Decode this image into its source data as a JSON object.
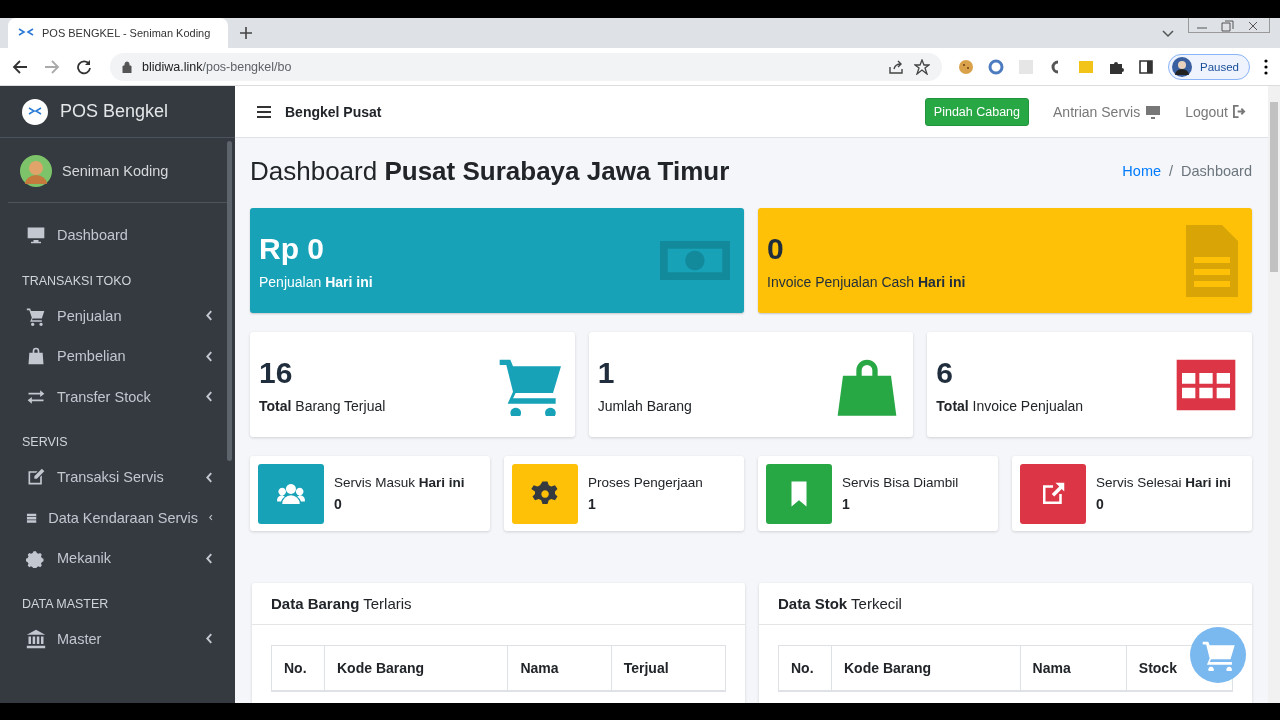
{
  "browser": {
    "tab_title": "POS BENGKEL - Seniman Koding",
    "url_host": "blidiwa.link",
    "url_path": "/pos-bengkel/bo",
    "profile_label": "Paused"
  },
  "sidebar": {
    "brand": "POS Bengkel",
    "user": "Seniman Koding",
    "menu": [
      {
        "kind": "item",
        "label": "Dashboard",
        "caret": false
      },
      {
        "kind": "header",
        "label": "TRANSAKSI TOKO"
      },
      {
        "kind": "item",
        "label": "Penjualan",
        "caret": true
      },
      {
        "kind": "item",
        "label": "Pembelian",
        "caret": true
      },
      {
        "kind": "item",
        "label": "Transfer Stock",
        "caret": true
      },
      {
        "kind": "header",
        "label": "SERVIS"
      },
      {
        "kind": "item",
        "label": "Transaksi Servis",
        "caret": true
      },
      {
        "kind": "item",
        "label": "Data Kendaraan Servis",
        "caret": true
      },
      {
        "kind": "item",
        "label": "Mekanik",
        "caret": true
      },
      {
        "kind": "header",
        "label": "DATA MASTER"
      },
      {
        "kind": "item",
        "label": "Master",
        "caret": true
      }
    ]
  },
  "navbar": {
    "title": "Bengkel Pusat",
    "branch_button": "Pindah Cabang",
    "queue_link": "Antrian Servis",
    "logout_link": "Logout"
  },
  "page": {
    "title": "Dashboard **Pusat Surabaya Jawa Timur**",
    "separator": "/",
    "breadcrumb": [
      {
        "label": "Home",
        "selected": false
      },
      {
        "label": "Dashboard",
        "selected": true
      }
    ]
  },
  "big_cards": [
    {
      "value": "Rp 0",
      "label": "Penjualan **Hari ini**",
      "color": "#17a2b8"
    },
    {
      "value": "0",
      "label": "Invoice Penjualan Cash **Hari ini**",
      "color": "#ffc107"
    }
  ],
  "stat_cards": [
    {
      "value": "16",
      "label": "**Total** Barang Terjual",
      "color": "#17a2b8"
    },
    {
      "value": "1",
      "label": "Jumlah Barang",
      "color": "#28a745"
    },
    {
      "value": "6",
      "label": "**Total** Invoice Penjualan",
      "color": "#dc3545"
    }
  ],
  "service_cards": [
    {
      "label": "Servis Masuk **Hari ini**",
      "value": "0",
      "color": "#17a2b8"
    },
    {
      "label": "Proses Pengerjaan",
      "value": "1",
      "color": "#ffc107"
    },
    {
      "label": "Servis Bisa Diambil",
      "value": "1",
      "color": "#28a745"
    },
    {
      "label": "Servis Selesai **Hari ini**",
      "value": "0",
      "color": "#dc3545"
    }
  ],
  "tables": [
    {
      "title": "**Data Barang** Terlaris",
      "columns": [
        "No.",
        "Kode Barang",
        "Nama",
        "Terjual"
      ]
    },
    {
      "title": "**Data Stok** Terkecil",
      "columns": [
        "No.",
        "Kode Barang",
        "Nama",
        "Stock"
      ]
    }
  ]
}
